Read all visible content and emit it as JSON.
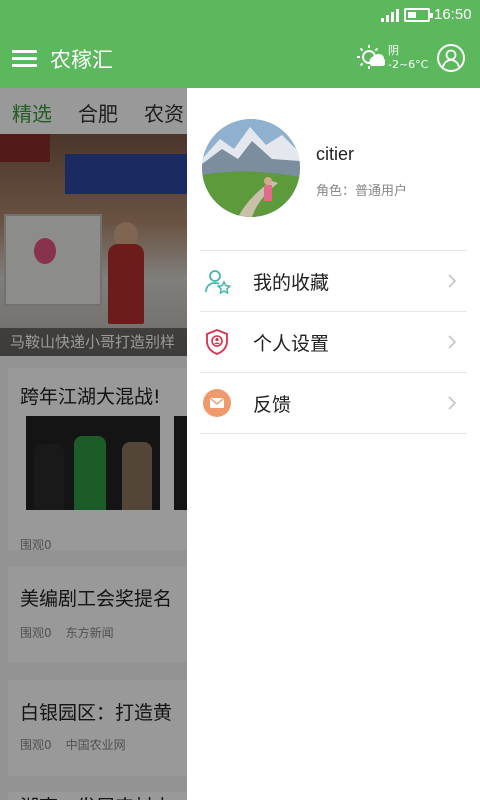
{
  "status_bar": {
    "time": "16:50",
    "battery_level": 0.45
  },
  "app_bar": {
    "title": "农稼汇",
    "weather": {
      "condition": "阴",
      "temperature": "-2~6°C"
    }
  },
  "tabs": [
    {
      "label": "精选",
      "active": true
    },
    {
      "label": "合肥",
      "active": false
    },
    {
      "label": "农资",
      "active": false
    }
  ],
  "feed": {
    "featured_caption": "马鞍山快递小哥打造别样",
    "items": [
      {
        "title": "跨年江湖大混战!",
        "views": "围观0",
        "source": ""
      },
      {
        "title": "美编剧工会奖提名",
        "views": "围观0",
        "source": "东方新闻"
      },
      {
        "title": "白银园区：打造黄",
        "views": "围观0",
        "source": "中国农业网"
      },
      {
        "title": "湖南：发展农村电",
        "views": "",
        "source": ""
      }
    ]
  },
  "drawer": {
    "username": "citier",
    "role": "角色：普通用户",
    "menu": [
      {
        "label": "我的收藏",
        "icon": "favorite-user-icon",
        "color": "#45b5ae"
      },
      {
        "label": "个人设置",
        "icon": "shield-settings-icon",
        "color": "#d9314a"
      },
      {
        "label": "反馈",
        "icon": "mail-icon",
        "color": "#f0996c"
      }
    ]
  },
  "colors": {
    "primary": "#5cb85c",
    "active_tab": "#3c9c3c"
  }
}
